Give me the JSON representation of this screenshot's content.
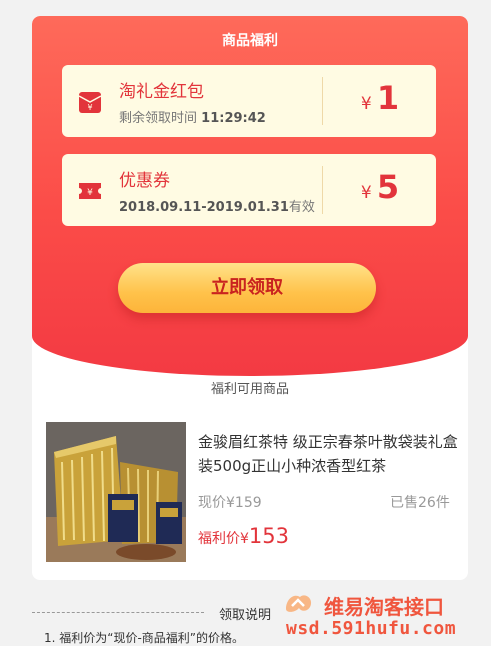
{
  "hero": {
    "title": "商品福利",
    "red_packet": {
      "name": "淘礼金红包",
      "label": "剩余领取时间",
      "time_left": "11:29:42",
      "currency": "¥",
      "amount": "1",
      "icon": "red-envelope-icon"
    },
    "coupon": {
      "name": "优惠券",
      "validity": "2018.09.11-2019.01.31",
      "validity_suffix": "有效",
      "currency": "¥",
      "amount": "5",
      "icon": "ticket-icon"
    },
    "claim_label": "立即领取"
  },
  "products_section": {
    "title": "福利可用商品",
    "product": {
      "title": "金骏眉红茶特 级正宗春茶叶散袋装礼盒装500g正山小种浓香型红茶",
      "price_label": "现价",
      "price": "¥159",
      "sold": "已售26件",
      "deal_label": "福利价",
      "deal_currency": "¥",
      "deal_price": "153"
    }
  },
  "rules": {
    "title": "领取说明",
    "items": [
      "1. 福利价为“现价-商品福利”的价格。"
    ]
  },
  "watermark": {
    "text": "维易淘客接口",
    "url": "wsd.591hufu.com"
  },
  "colors": {
    "hero_top": "#fe6a5a",
    "hero_bottom": "#f33a43",
    "accent_red": "#e2343b",
    "perk_bg": "#fffbe3",
    "button_gold": "#ffc24a"
  }
}
